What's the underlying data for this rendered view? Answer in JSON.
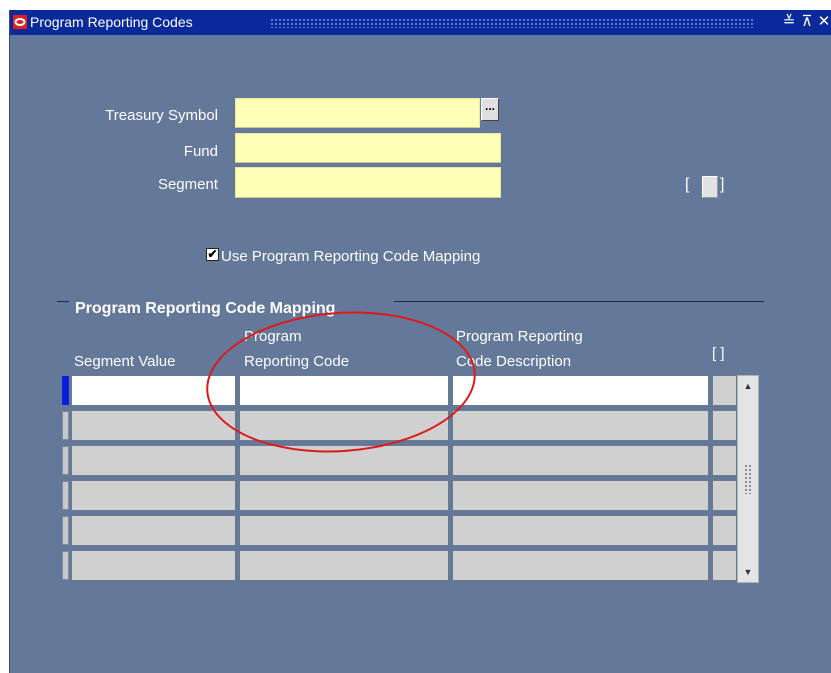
{
  "window": {
    "title": "Program Reporting Codes",
    "controls": {
      "minimize": "≚",
      "maximize": "⊼",
      "close": "✕"
    }
  },
  "header_form": {
    "treasury_symbol": {
      "label": "Treasury Symbol",
      "value": ""
    },
    "fund": {
      "label": "Fund",
      "value": ""
    },
    "segment": {
      "label": "Segment",
      "value": ""
    },
    "lov_button": "...",
    "bracket_left": "[",
    "bracket_right": "]"
  },
  "mapping_checkbox": {
    "label": "Use Program Reporting Code Mapping",
    "checked": true,
    "mark": "✔"
  },
  "mapping_section": {
    "title": "Program Reporting Code Mapping",
    "columns": {
      "segment_value": "Segment Value",
      "program_reporting_code_line1": "Program",
      "program_reporting_code_line2": "Reporting Code",
      "description_line1": "Program Reporting",
      "description_line2": "Code Description",
      "flex_bracket": "[ ]"
    },
    "rows": [
      {
        "segment_value": "",
        "program_reporting_code": "",
        "description": ""
      },
      {
        "segment_value": "",
        "program_reporting_code": "",
        "description": ""
      },
      {
        "segment_value": "",
        "program_reporting_code": "",
        "description": ""
      },
      {
        "segment_value": "",
        "program_reporting_code": "",
        "description": ""
      },
      {
        "segment_value": "",
        "program_reporting_code": "",
        "description": ""
      },
      {
        "segment_value": "",
        "program_reporting_code": "",
        "description": ""
      }
    ],
    "scroll_up": "▲",
    "scroll_down": "▼"
  },
  "colors": {
    "canvas": "#64789a",
    "titlebar": "#0a2a9c",
    "required_field": "#ffffb8",
    "annotation": "#e01818"
  }
}
